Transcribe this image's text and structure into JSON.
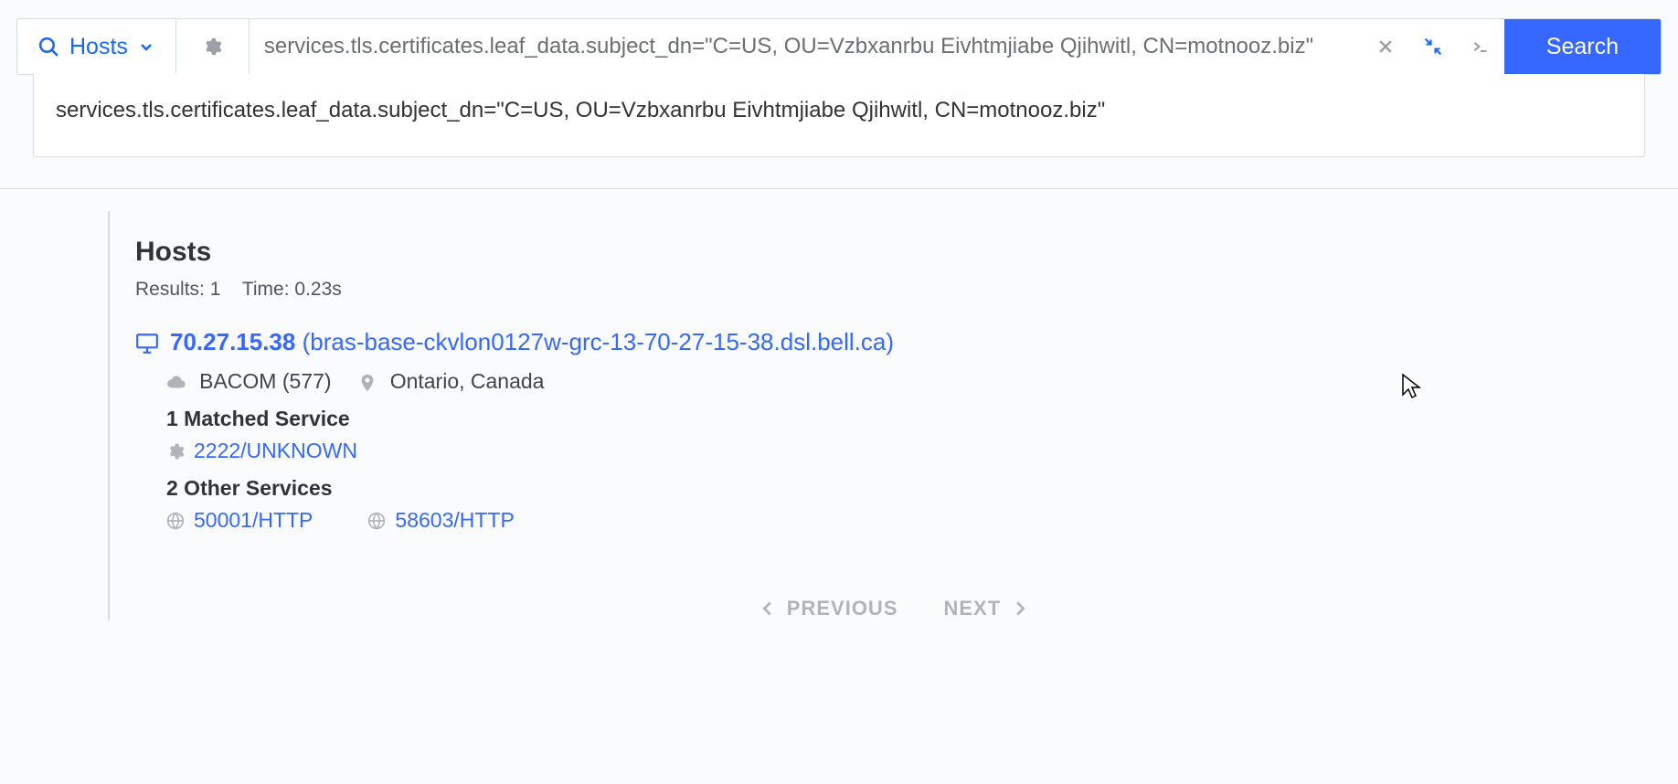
{
  "search": {
    "scope_label": "Hosts",
    "input_value": "services.tls.certificates.leaf_data.subject_dn=\"C=US, OU=Vzbxanrbu Eivhtmjiabe Qjihwitl, CN=motnooz.biz\"",
    "button_label": "Search"
  },
  "suggestion": "services.tls.certificates.leaf_data.subject_dn=\"C=US, OU=Vzbxanrbu Eivhtmjiabe Qjihwitl, CN=motnooz.biz\"",
  "results": {
    "title": "Hosts",
    "results_label": "Results: 1",
    "time_label": "Time: 0.23s"
  },
  "host": {
    "ip": "70.27.15.38",
    "hostname": "(bras-base-ckvlon0127w-grc-13-70-27-15-38.dsl.bell.ca)",
    "asn": "BACOM (577)",
    "location": "Ontario, Canada",
    "matched_heading": "1 Matched Service",
    "matched_services": [
      {
        "label": "2222/UNKNOWN",
        "icon": "gear"
      }
    ],
    "other_heading": "2 Other Services",
    "other_services": [
      {
        "label": "50001/HTTP",
        "icon": "globe"
      },
      {
        "label": "58603/HTTP",
        "icon": "globe"
      }
    ]
  },
  "pagination": {
    "prev": "PREVIOUS",
    "next": "NEXT"
  }
}
